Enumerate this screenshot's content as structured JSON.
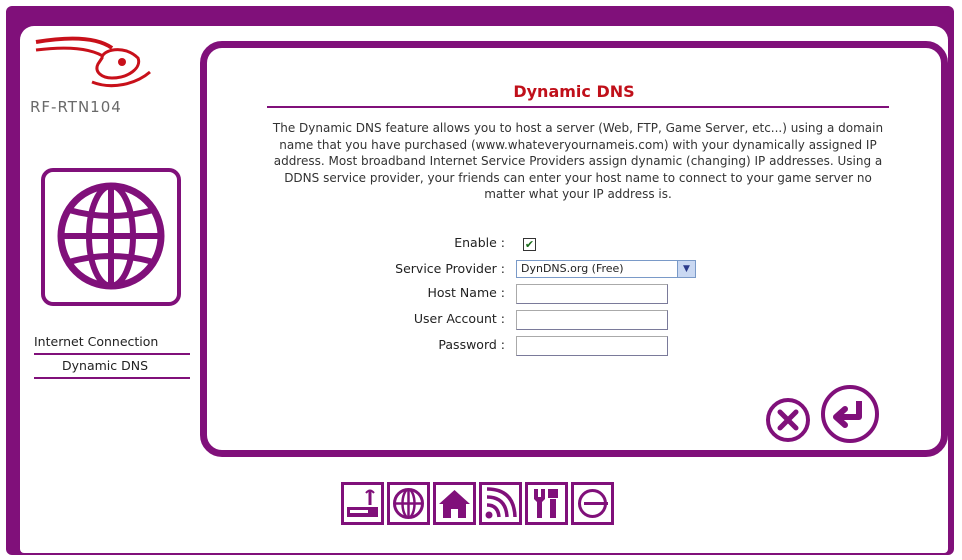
{
  "brand": {
    "model": "RF-RTN104"
  },
  "sidebar": {
    "items": [
      {
        "label": "Internet Connection",
        "icon": "globe-icon"
      },
      {
        "label": "Dynamic DNS"
      }
    ]
  },
  "main": {
    "title": "Dynamic DNS",
    "description": "The Dynamic DNS feature allows you to host a server (Web, FTP, Game Server, etc...) using a domain name that you have purchased (www.whateveryournameis.com) with your dynamically assigned IP address. Most broadband Internet Service Providers assign dynamic (changing) IP addresses. Using a DDNS service provider, your friends can enter your host name to connect to your game server no matter what your IP address is.",
    "fields": {
      "enable": {
        "label": "Enable :",
        "checked": true
      },
      "service_provider": {
        "label": "Service Provider :",
        "value": "DynDNS.org (Free)"
      },
      "host_name": {
        "label": "Host Name :",
        "value": ""
      },
      "user_account": {
        "label": "User Account :",
        "value": ""
      },
      "password": {
        "label": "Password :",
        "value": ""
      }
    },
    "buttons": [
      {
        "name": "cancel",
        "icon": "close-circle-icon"
      },
      {
        "name": "apply",
        "icon": "return-arrow-icon"
      }
    ]
  },
  "bottom_bar": {
    "icons": [
      "router-icon",
      "globe-icon",
      "home-icon",
      "wireless-icon",
      "tools-icon",
      "logout-icon"
    ]
  },
  "colors": {
    "frame": "#80107a",
    "title": "#c0101a"
  }
}
